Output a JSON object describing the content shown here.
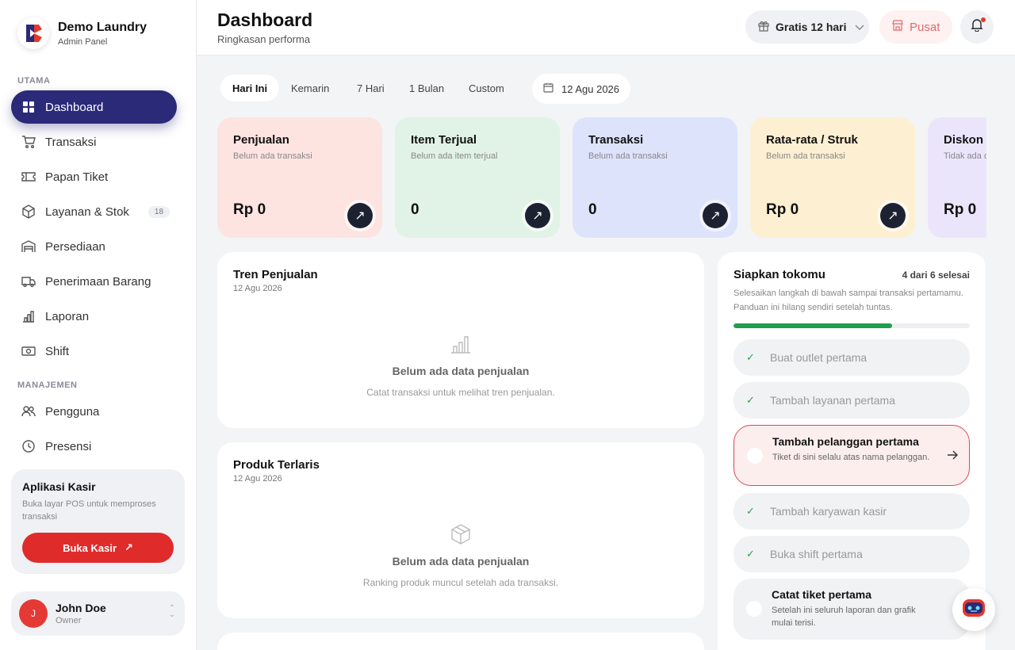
{
  "brand": {
    "name": "Demo Laundry",
    "subtitle": "Admin Panel"
  },
  "sidebar": {
    "section_main": "UTAMA",
    "section_manage": "MANAJEMEN",
    "items": [
      {
        "label": "Dashboard",
        "icon": "grid-icon",
        "active": true
      },
      {
        "label": "Transaksi",
        "icon": "cart-icon"
      },
      {
        "label": "Papan Tiket",
        "icon": "ticket-icon"
      },
      {
        "label": "Layanan & Stok",
        "icon": "box-icon",
        "badge": "18"
      },
      {
        "label": "Persediaan",
        "icon": "warehouse-icon"
      },
      {
        "label": "Penerimaan Barang",
        "icon": "truck-icon"
      },
      {
        "label": "Laporan",
        "icon": "bar-chart-icon"
      },
      {
        "label": "Shift",
        "icon": "cash-icon"
      },
      {
        "label": "Pengguna",
        "icon": "users-icon"
      },
      {
        "label": "Presensi",
        "icon": "clock-icon"
      }
    ]
  },
  "kasir": {
    "title": "Aplikasi Kasir",
    "description": "Buka layar POS untuk memproses transaksi",
    "button": "Buka Kasir"
  },
  "user": {
    "initial": "J",
    "name": "John Doe",
    "role": "Owner"
  },
  "header": {
    "title": "Dashboard",
    "subtitle": "Ringkasan performa",
    "plan": "Gratis 12 hari",
    "pusat": "Pusat"
  },
  "filters": {
    "tabs": [
      "Hari Ini",
      "Kemarin",
      "7 Hari",
      "1 Bulan",
      "Custom"
    ],
    "active_tab": "Hari Ini",
    "date": "12 Agu 2026"
  },
  "stats": [
    {
      "title": "Penjualan",
      "subtitle": "Belum ada transaksi",
      "value": "Rp 0",
      "color": "#fde4e1"
    },
    {
      "title": "Item Terjual",
      "subtitle": "Belum ada item terjual",
      "value": "0",
      "color": "#e1f3e6"
    },
    {
      "title": "Transaksi",
      "subtitle": "Belum ada transaksi",
      "value": "0",
      "color": "#dde3fb"
    },
    {
      "title": "Rata-rata / Struk",
      "subtitle": "Belum ada transaksi",
      "value": "Rp 0",
      "color": "#fdefd2"
    },
    {
      "title": "Diskon",
      "subtitle": "Tidak ada diskon",
      "value": "Rp 0",
      "color": "#ebe5fb"
    }
  ],
  "trend": {
    "title": "Tren Penjualan",
    "date": "12 Agu 2026",
    "empty_title": "Belum ada data penjualan",
    "empty_sub": "Catat transaksi untuk melihat tren penjualan."
  },
  "top_products": {
    "title": "Produk Terlaris",
    "date": "12 Agu 2026",
    "empty_title": "Belum ada data penjualan",
    "empty_sub": "Ranking produk muncul setelah ada transaksi."
  },
  "setup": {
    "title": "Siapkan tokomu",
    "count": "4 dari 6 selesai",
    "progress": 0.67,
    "description": "Selesaikan langkah di bawah sampai transaksi pertamamu. Panduan ini hilang sendiri setelah tuntas.",
    "steps": [
      {
        "title": "Buat outlet pertama",
        "status": "done"
      },
      {
        "title": "Tambah layanan pertama",
        "status": "done"
      },
      {
        "title": "Tambah pelanggan pertama",
        "status": "active",
        "description": "Tiket di sini selalu atas nama pelanggan."
      },
      {
        "title": "Tambah karyawan kasir",
        "status": "done"
      },
      {
        "title": "Buka shift pertama",
        "status": "done"
      },
      {
        "title": "Catat tiket pertama",
        "status": "todo",
        "description": "Setelah ini seluruh laporan dan grafik mulai terisi."
      }
    ]
  }
}
